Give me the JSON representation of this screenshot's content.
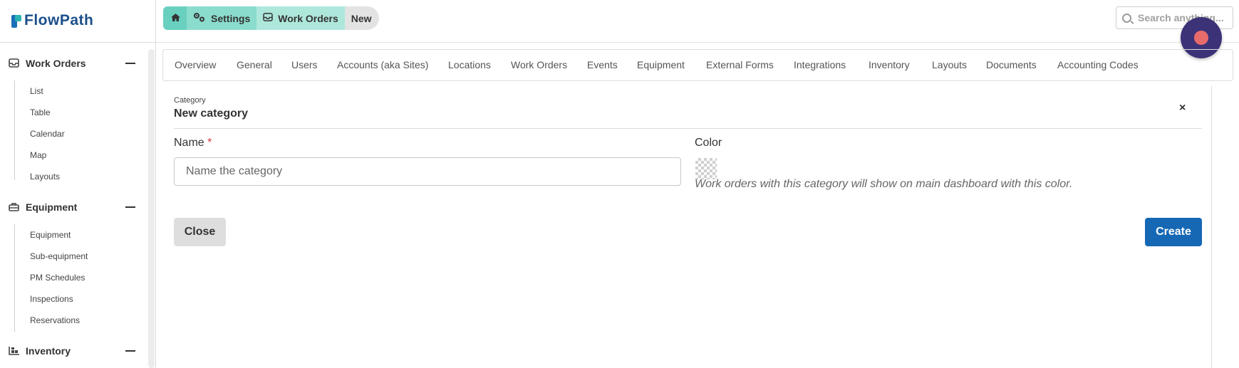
{
  "app": {
    "logo_text_flow": "Flow",
    "logo_text_path": "Path"
  },
  "sidebar": {
    "sections": [
      {
        "title": "Work Orders",
        "icon": "inbox-icon",
        "items": [
          "List",
          "Table",
          "Calendar",
          "Map",
          "Layouts"
        ]
      },
      {
        "title": "Equipment",
        "icon": "toolbox-icon",
        "items": [
          "Equipment",
          "Sub-equipment",
          "PM Schedules",
          "Inspections",
          "Reservations"
        ]
      },
      {
        "title": "Inventory",
        "icon": "warehouse-icon",
        "items": []
      }
    ]
  },
  "breadcrumb": {
    "items": [
      {
        "label": "",
        "icon": "home-icon"
      },
      {
        "label": "Settings",
        "icon": "gears-icon"
      },
      {
        "label": "Work Orders",
        "icon": "inbox-icon"
      },
      {
        "label": "New",
        "icon": ""
      }
    ]
  },
  "search": {
    "placeholder": "Search anything..."
  },
  "tabs": [
    "Overview",
    "General",
    "Users",
    "Accounts (aka Sites)",
    "Locations",
    "Work Orders",
    "Events",
    "Equipment",
    "External Forms",
    "Integrations",
    "Inventory",
    "Layouts",
    "Documents",
    "Accounting Codes"
  ],
  "panel": {
    "eyebrow": "Category",
    "title": "New category",
    "close_symbol": "×",
    "name_label": "Name",
    "required_mark": "*",
    "name_placeholder": "Name the category",
    "name_value": "",
    "color_label": "Color",
    "color_help": "Work orders with this category will show on main dashboard with this color.",
    "close_button": "Close",
    "create_button": "Create"
  },
  "colors": {
    "primary": "#1668b5",
    "teal": "#69d0c0",
    "record_bg": "#3c3278",
    "record_dot": "#e86b6b"
  }
}
